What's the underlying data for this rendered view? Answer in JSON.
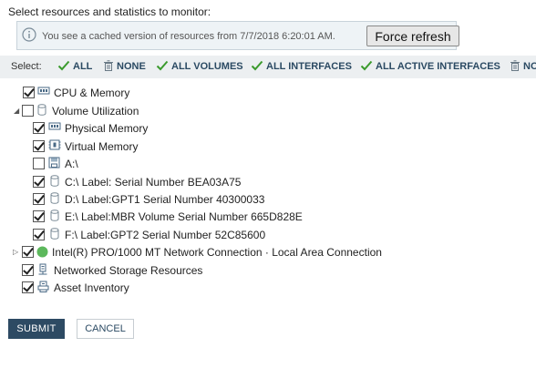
{
  "heading": "Select resources and statistics to monitor:",
  "info": {
    "text": "You see a cached version of resources from 7/7/2018 6:20:01 AM.",
    "button": "Force refresh"
  },
  "select_bar": {
    "label": "Select:",
    "items": [
      "ALL",
      "NONE",
      "ALL VOLUMES",
      "ALL INTERFACES",
      "ALL ACTIVE INTERFACES",
      "NO"
    ]
  },
  "tree": [
    {
      "label": "CPU & Memory",
      "checked": true,
      "icon": "cpu-icon",
      "expander": "none"
    },
    {
      "label": "Volume Utilization",
      "checked": false,
      "icon": "volume-icon",
      "expander": "expanded"
    },
    {
      "label": "Physical Memory",
      "checked": true,
      "icon": "memory-icon",
      "expander": "none"
    },
    {
      "label": "Virtual Memory",
      "checked": true,
      "icon": "virtual-memory-icon",
      "expander": "none"
    },
    {
      "label": "A:\\",
      "checked": false,
      "icon": "floppy-icon",
      "expander": "none"
    },
    {
      "label": "C:\\ Label: Serial Number BEA03A75",
      "checked": true,
      "icon": "disk-icon",
      "expander": "none"
    },
    {
      "label": "D:\\ Label:GPT1 Serial Number 40300033",
      "checked": true,
      "icon": "disk-icon",
      "expander": "none"
    },
    {
      "label": "E:\\ Label:MBR Volume Serial Number 665D828E",
      "checked": true,
      "icon": "disk-icon",
      "expander": "none"
    },
    {
      "label": "F:\\ Label:GPT2 Serial Number 52C85600",
      "checked": true,
      "icon": "disk-icon",
      "expander": "none"
    },
    {
      "label": "Intel(R) PRO/1000 MT Network Connection · Local Area Connection",
      "checked": true,
      "icon": "network-status-icon",
      "expander": "collapsed"
    },
    {
      "label": "Networked Storage Resources",
      "checked": true,
      "icon": "storage-icon",
      "expander": "none"
    },
    {
      "label": "Asset Inventory",
      "checked": true,
      "icon": "inventory-icon",
      "expander": "none"
    }
  ],
  "colors": {
    "accent": "#2d4a63",
    "check_green": "#3a9a2c",
    "status_green": "#5cb85c",
    "info_bg": "#eef3f6",
    "select_bar_bg": "#eceff1"
  },
  "buttons": {
    "submit": "SUBMIT",
    "cancel": "CANCEL"
  }
}
